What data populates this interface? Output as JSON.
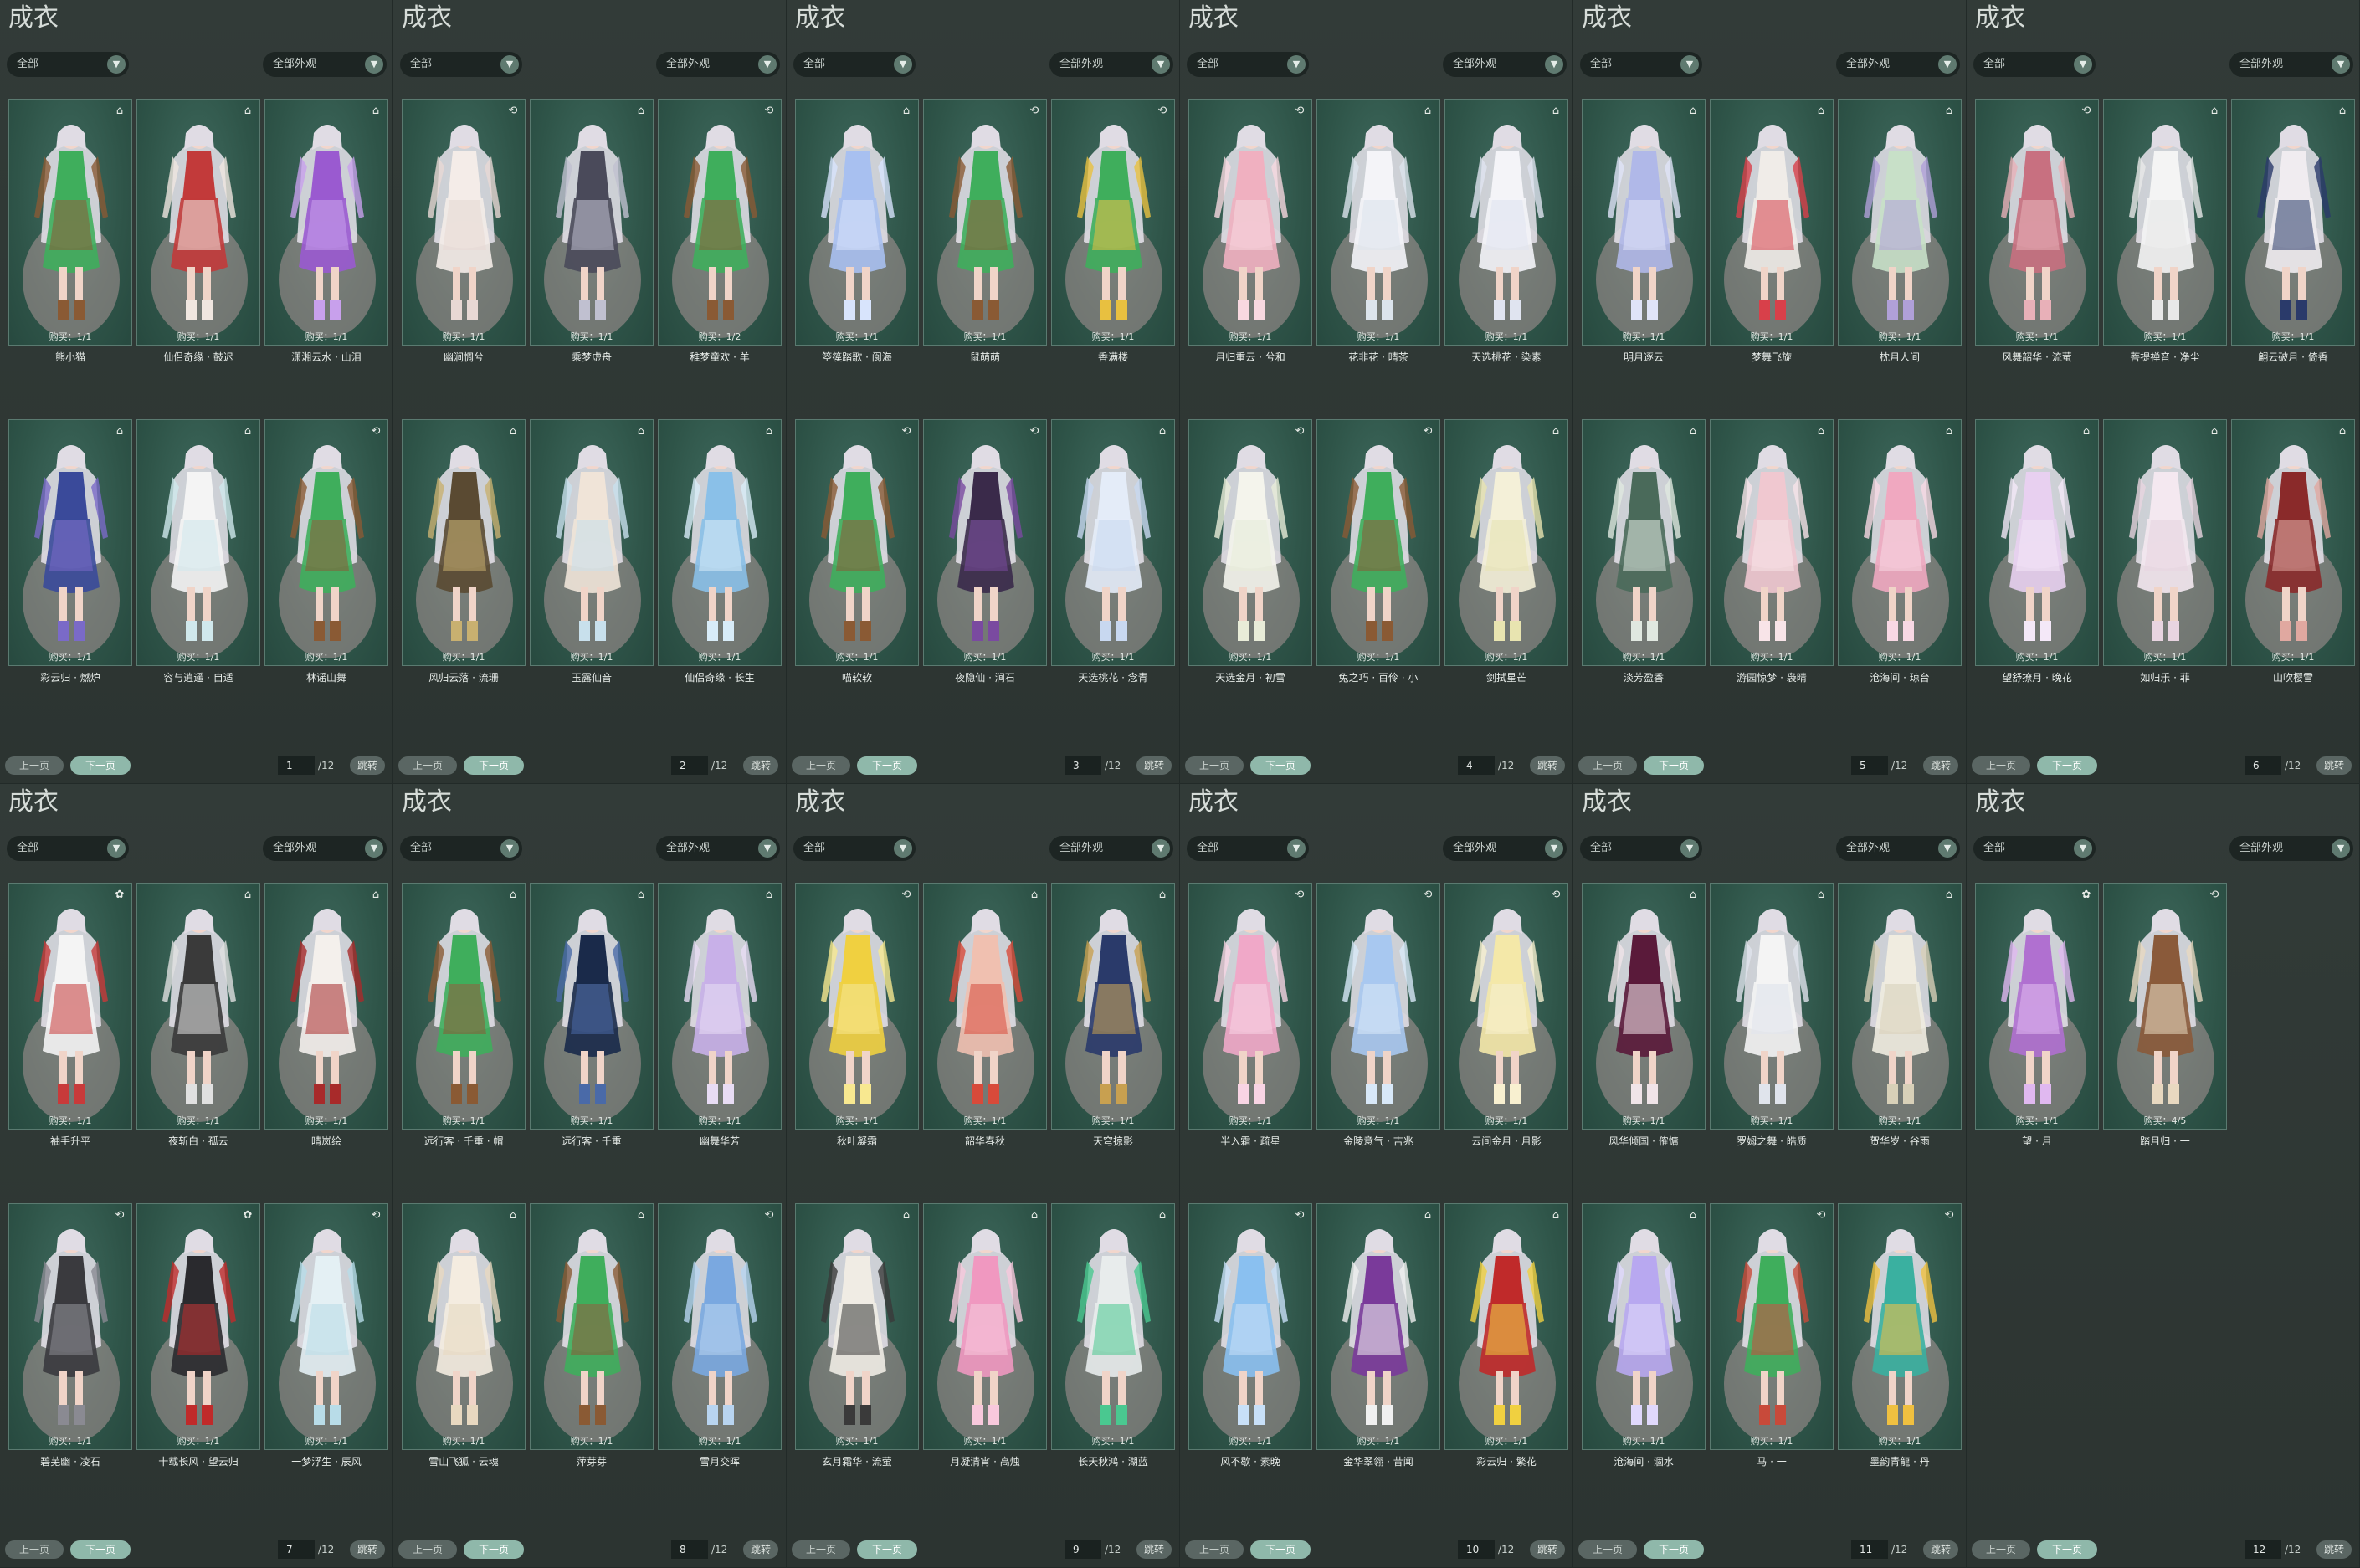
{
  "panel_title": "成衣",
  "filter_all": "全部",
  "filter_appearance": "全部外观",
  "prev_label": "上一页",
  "next_label": "下一页",
  "jump_label": "跳转",
  "total_pages": "/12",
  "colors": {
    "card_bg": "#2f5549",
    "card_border": "#5a7a70",
    "next_button": "#8fb8aa",
    "panel_bg": "#2c3431"
  },
  "panels": [
    {
      "page": "1",
      "items": [
        {
          "name": "熊小猫",
          "buy": "购买：1/1",
          "icon": "gift-icon",
          "palette": [
            "#3fae5c",
            "#8a5a34"
          ]
        },
        {
          "name": "仙侣奇缘 · 鼓迟",
          "buy": "购买：1/1",
          "icon": "gift-icon",
          "palette": [
            "#c23a3a",
            "#f0e6e0"
          ]
        },
        {
          "name": "潇湘云水 · 山泪",
          "buy": "购买：1/1",
          "icon": "gift-icon",
          "palette": [
            "#9a5ad0",
            "#c8a0ec"
          ]
        },
        {
          "name": "彩云归 · 燃炉",
          "buy": "购买：1/1",
          "icon": "gift-icon",
          "palette": [
            "#3a4a9a",
            "#7a6ac8"
          ]
        },
        {
          "name": "容与逍遥 · 自适",
          "buy": "购买：1/1",
          "icon": "gift-icon",
          "palette": [
            "#f4f4f4",
            "#d0e8ec"
          ]
        },
        {
          "name": "林谣山舞",
          "buy": "购买：1/1",
          "icon": "swap-icon",
          "palette": [
            "#3fae5c",
            "#8a5a34"
          ]
        }
      ]
    },
    {
      "page": "2",
      "items": [
        {
          "name": "幽涧惆兮",
          "buy": "购买：1/1",
          "icon": "swap-icon",
          "palette": [
            "#f4ece8",
            "#e8d8d4"
          ]
        },
        {
          "name": "乘梦虚舟",
          "buy": "购买：1/1",
          "icon": "gift-icon",
          "palette": [
            "#4a4a5a",
            "#c0c0d0"
          ]
        },
        {
          "name": "稚梦童欢 · 羊",
          "buy": "购买：1/2",
          "icon": "swap-icon",
          "palette": [
            "#3fae5c",
            "#8a5a34"
          ]
        },
        {
          "name": "风归云落 · 流珊",
          "buy": "购买：1/1",
          "icon": "gift-icon",
          "palette": [
            "#5a4a32",
            "#c8b070"
          ]
        },
        {
          "name": "玉露仙音",
          "buy": "购买：1/1",
          "icon": "gift-icon",
          "palette": [
            "#f0e4d8",
            "#c8e0ec"
          ]
        },
        {
          "name": "仙侣奇缘 · 长生",
          "buy": "购买：1/1",
          "icon": "gift-icon",
          "palette": [
            "#8ac0e8",
            "#d8ecf8"
          ]
        }
      ]
    },
    {
      "page": "3",
      "items": [
        {
          "name": "箜篌踏歌 · 阆海",
          "buy": "购买：1/1",
          "icon": "gift-icon",
          "palette": [
            "#a8c0f0",
            "#d8e4fc"
          ]
        },
        {
          "name": "鼠萌萌",
          "buy": "购买：1/1",
          "icon": "swap-icon",
          "palette": [
            "#3fae5c",
            "#8a5a34"
          ]
        },
        {
          "name": "香满楼",
          "buy": "购买：1/1",
          "icon": "swap-icon",
          "palette": [
            "#3fae5c",
            "#e8c040"
          ]
        },
        {
          "name": "喵软软",
          "buy": "购买：1/1",
          "icon": "swap-icon",
          "palette": [
            "#3fae5c",
            "#8a5a34"
          ]
        },
        {
          "name": "夜隐仙 · 涧石",
          "buy": "购买：1/1",
          "icon": "swap-icon",
          "palette": [
            "#3a2a4a",
            "#7a4aa0"
          ]
        },
        {
          "name": "天选桃花 · 念青",
          "buy": "购买：1/1",
          "icon": "gift-icon",
          "palette": [
            "#e4ecf8",
            "#c8d8f0"
          ]
        }
      ]
    },
    {
      "page": "4",
      "items": [
        {
          "name": "月归重云 · 兮和",
          "buy": "购买：1/1",
          "icon": "swap-icon",
          "palette": [
            "#f0b0c0",
            "#f8d8e0"
          ]
        },
        {
          "name": "花非花 · 晴茶",
          "buy": "购买：1/1",
          "icon": "gift-icon",
          "palette": [
            "#f4f4f8",
            "#dce4ec"
          ]
        },
        {
          "name": "天选桃花 · 染素",
          "buy": "购买：1/1",
          "icon": "gift-icon",
          "palette": [
            "#f4f4f8",
            "#e0e4f0"
          ]
        },
        {
          "name": "天选金月 · 初雪",
          "buy": "购买：1/1",
          "icon": "swap-icon",
          "palette": [
            "#f4f4ec",
            "#e8ecd8"
          ]
        },
        {
          "name": "兔之巧 · 百伶 · 小",
          "buy": "购买：1/1",
          "icon": "swap-icon",
          "palette": [
            "#3fae5c",
            "#8a5a34"
          ]
        },
        {
          "name": "剑拭星芒",
          "buy": "购买：1/1",
          "icon": "gift-icon",
          "palette": [
            "#f4f0d8",
            "#e8e4b0"
          ]
        }
      ]
    },
    {
      "page": "5",
      "items": [
        {
          "name": "明月逐云",
          "buy": "购买：1/1",
          "icon": "gift-icon",
          "palette": [
            "#b0b8e8",
            "#e0e4f8"
          ]
        },
        {
          "name": "梦舞飞旋",
          "buy": "购买：1/1",
          "icon": "gift-icon",
          "palette": [
            "#f0ece8",
            "#d8404a"
          ]
        },
        {
          "name": "枕月人间",
          "buy": "购买：1/1",
          "icon": "gift-icon",
          "palette": [
            "#c8e0c8",
            "#b0a0d8"
          ]
        },
        {
          "name": "淡芳盈香",
          "buy": "购买：1/1",
          "icon": "gift-icon",
          "palette": [
            "#4a6a5a",
            "#e0e8e0"
          ]
        },
        {
          "name": "游园惊梦 · 袅晴",
          "buy": "购买：1/1",
          "icon": "gift-icon",
          "palette": [
            "#f0c8d0",
            "#f8e4e8"
          ]
        },
        {
          "name": "沧海间 · 琼台",
          "buy": "购买：1/1",
          "icon": "gift-icon",
          "palette": [
            "#f0a8c0",
            "#f8d8e4"
          ]
        }
      ]
    },
    {
      "page": "6",
      "items": [
        {
          "name": "风舞韶华 · 流萤",
          "buy": "购买：1/1",
          "icon": "swap-icon",
          "palette": [
            "#c87080",
            "#e8b0b8"
          ]
        },
        {
          "name": "菩提禅音 · 净尘",
          "buy": "购买：1/1",
          "icon": "gift-icon",
          "palette": [
            "#f4f4f4",
            "#e8e8e8"
          ]
        },
        {
          "name": "翩云破月 · 倚香",
          "buy": "购买：1/1",
          "icon": "gift-icon",
          "palette": [
            "#f0ecf0",
            "#2a3a6a"
          ]
        },
        {
          "name": "望舒撩月 · 晚花",
          "buy": "购买：1/1",
          "icon": "gift-icon",
          "palette": [
            "#e8d0f0",
            "#f4e8f8"
          ]
        },
        {
          "name": "如归乐 · 菲",
          "buy": "购买：1/1",
          "icon": "gift-icon",
          "palette": [
            "#f4e8f0",
            "#e8d4e0"
          ]
        },
        {
          "name": "山吹樱雪",
          "buy": "购买：1/1",
          "icon": "gift-icon",
          "palette": [
            "#8a2a2a",
            "#e0a8a0"
          ]
        }
      ]
    },
    {
      "page": "7",
      "items": [
        {
          "name": "袖手升平",
          "buy": "购买：1/1",
          "icon": "butterfly-icon",
          "palette": [
            "#f4f4f4",
            "#c83a3a"
          ]
        },
        {
          "name": "夜斩白 · 孤云",
          "buy": "购买：1/1",
          "icon": "gift-icon",
          "palette": [
            "#3a3a3a",
            "#e0e0e0"
          ]
        },
        {
          "name": "晴岚绘",
          "buy": "购买：1/1",
          "icon": "gift-icon",
          "palette": [
            "#f4f0ec",
            "#a82a2a"
          ]
        },
        {
          "name": "碧芜幽 · 凌石",
          "buy": "购买：1/1",
          "icon": "swap-icon",
          "palette": [
            "#3a3a3e",
            "#8a8a92"
          ]
        },
        {
          "name": "十载长风 · 望云归",
          "buy": "购买：1/1",
          "icon": "butterfly-icon",
          "palette": [
            "#2a2a2e",
            "#c02a2a"
          ]
        },
        {
          "name": "一梦浮生 · 辰风",
          "buy": "购买：1/1",
          "icon": "swap-icon",
          "palette": [
            "#e4f0f4",
            "#b8dce8"
          ]
        }
      ]
    },
    {
      "page": "8",
      "items": [
        {
          "name": "远行客 · 千重 · 帽",
          "buy": "购买：1/1",
          "icon": "gift-icon",
          "palette": [
            "#3fae5c",
            "#8a5a34"
          ]
        },
        {
          "name": "远行客 · 千重",
          "buy": "购买：1/1",
          "icon": "gift-icon",
          "palette": [
            "#1a2a4a",
            "#4a6aa8"
          ]
        },
        {
          "name": "幽舞华芳",
          "buy": "购买：1/1",
          "icon": "gift-icon",
          "palette": [
            "#c8b0e8",
            "#e8dcf4"
          ]
        },
        {
          "name": "雪山飞狐 · 云魂",
          "buy": "购买：1/1",
          "icon": "gift-icon",
          "palette": [
            "#f4ece0",
            "#e8d8c0"
          ]
        },
        {
          "name": "萍芽芽",
          "buy": "购买：1/1",
          "icon": "gift-icon",
          "palette": [
            "#3fae5c",
            "#8a5a34"
          ]
        },
        {
          "name": "雪月交晖",
          "buy": "购买：1/1",
          "icon": "swap-icon",
          "palette": [
            "#7aa8e0",
            "#b8d4f0"
          ]
        }
      ]
    },
    {
      "page": "9",
      "items": [
        {
          "name": "秋叶凝霜",
          "buy": "购买：1/1",
          "icon": "swap-icon",
          "palette": [
            "#f0d040",
            "#f8e890"
          ]
        },
        {
          "name": "韶华春秋",
          "buy": "购买：1/1",
          "icon": "gift-icon",
          "palette": [
            "#f0c0b0",
            "#d84a3a"
          ]
        },
        {
          "name": "天穹掠影",
          "buy": "购买：1/1",
          "icon": "gift-icon",
          "palette": [
            "#2a3a6a",
            "#c8a050"
          ]
        },
        {
          "name": "玄月霜华 · 流萤",
          "buy": "购买：1/1",
          "icon": "gift-icon",
          "palette": [
            "#f0ece4",
            "#3a3a3a"
          ]
        },
        {
          "name": "月凝清宵 · 高烛",
          "buy": "购买：1/1",
          "icon": "gift-icon",
          "palette": [
            "#f098c0",
            "#f8c8dc"
          ]
        },
        {
          "name": "长天秋鸿 · 湖蓝",
          "buy": "购买：1/1",
          "icon": "gift-icon",
          "palette": [
            "#e8ecec",
            "#4ac890"
          ]
        }
      ]
    },
    {
      "page": "10",
      "items": [
        {
          "name": "半入霜 · 疏星",
          "buy": "购买：1/1",
          "icon": "swap-icon",
          "palette": [
            "#f0a8c8",
            "#f8d4e4"
          ]
        },
        {
          "name": "金陵意气 · 吉兆",
          "buy": "购买：1/1",
          "icon": "swap-icon",
          "palette": [
            "#a8c8f0",
            "#d8e8f8"
          ]
        },
        {
          "name": "云间金月 · 月影",
          "buy": "购买：1/1",
          "icon": "swap-icon",
          "palette": [
            "#f4e8a8",
            "#f8f0d0"
          ]
        },
        {
          "name": "风不歇 · 素晚",
          "buy": "购买：1/1",
          "icon": "swap-icon",
          "palette": [
            "#8ac0f0",
            "#c8e0f8"
          ]
        },
        {
          "name": "金华翠翎 · 昔闻",
          "buy": "购买：1/1",
          "icon": "gift-icon",
          "palette": [
            "#7a3a9a",
            "#f0f0f0"
          ]
        },
        {
          "name": "彩云归 · 繁花",
          "buy": "购买：1/1",
          "icon": "gift-icon",
          "palette": [
            "#c02a2a",
            "#f0d040"
          ]
        }
      ]
    },
    {
      "page": "11",
      "items": [
        {
          "name": "风华倾国 · 傕慵",
          "buy": "购买：1/1",
          "icon": "gift-icon",
          "palette": [
            "#5a1a3a",
            "#f0e4e8"
          ]
        },
        {
          "name": "罗姆之舞 · 皓质",
          "buy": "购买：1/1",
          "icon": "gift-icon",
          "palette": [
            "#f4f4f4",
            "#e0e4ec"
          ]
        },
        {
          "name": "贺华岁 · 谷雨",
          "buy": "购买：1/1",
          "icon": "gift-icon",
          "palette": [
            "#f0ece0",
            "#d8d0b8"
          ]
        },
        {
          "name": "沧海间 · 涸水",
          "buy": "购买：1/1",
          "icon": "gift-icon",
          "palette": [
            "#b8a8f0",
            "#e0d8fc"
          ]
        },
        {
          "name": "马 · 一",
          "buy": "购买：1/1",
          "icon": "swap-icon",
          "palette": [
            "#3fae5c",
            "#c84a3a"
          ]
        },
        {
          "name": "墨韵青龍 · 丹",
          "buy": "购买：1/1",
          "icon": "swap-icon",
          "palette": [
            "#3ab0a0",
            "#f0c040"
          ]
        }
      ]
    },
    {
      "page": "12",
      "items": [
        {
          "name": "望 · 月",
          "buy": "购买：1/1",
          "icon": "butterfly-icon",
          "palette": [
            "#b070d0",
            "#e0b8f0"
          ]
        },
        {
          "name": "踏月归 · 一",
          "buy": "购买：4/5",
          "icon": "swap-icon",
          "palette": [
            "#8a5a3a",
            "#e8d8c0"
          ]
        }
      ]
    }
  ]
}
